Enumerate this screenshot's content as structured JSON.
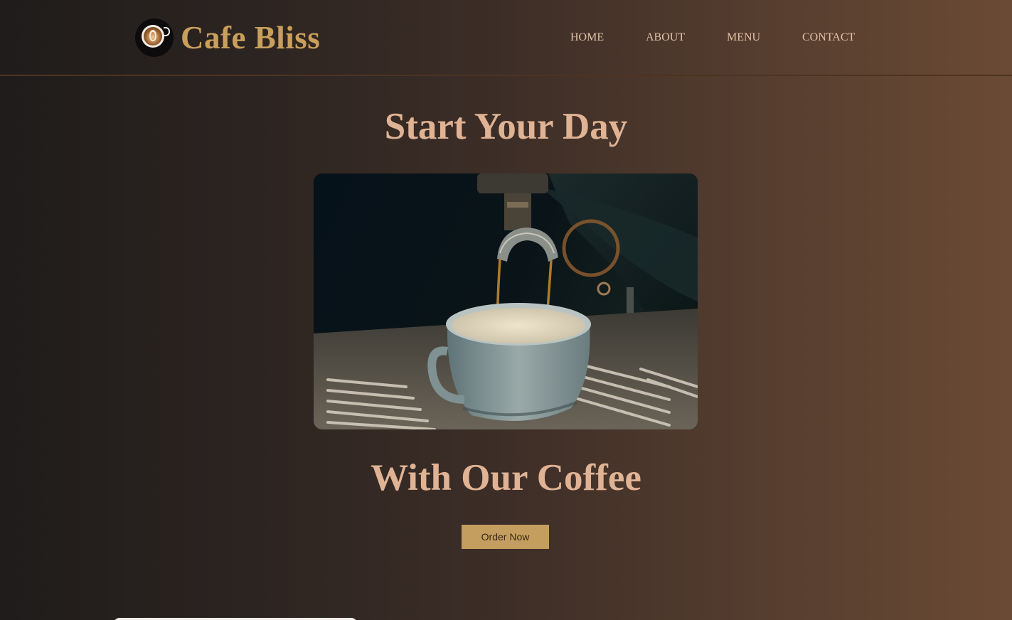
{
  "header": {
    "brand": "Cafe Bliss",
    "logo_icon": "coffee-cup-latte-art-icon",
    "nav": [
      {
        "label": "HOME"
      },
      {
        "label": "ABOUT"
      },
      {
        "label": "MENU"
      },
      {
        "label": "CONTACT"
      }
    ]
  },
  "hero": {
    "title_top": "Start Your Day",
    "title_bottom": "With Our Coffee",
    "cta_label": "Order Now",
    "image_subject": "espresso pouring into a cup"
  },
  "colors": {
    "brand": "#c99f5c",
    "heading": "#e0b394",
    "nav_text": "#e3c2a7",
    "button_bg": "#c49e5e",
    "background_left": "#1f1c1b",
    "background_right": "#6a4a34"
  }
}
